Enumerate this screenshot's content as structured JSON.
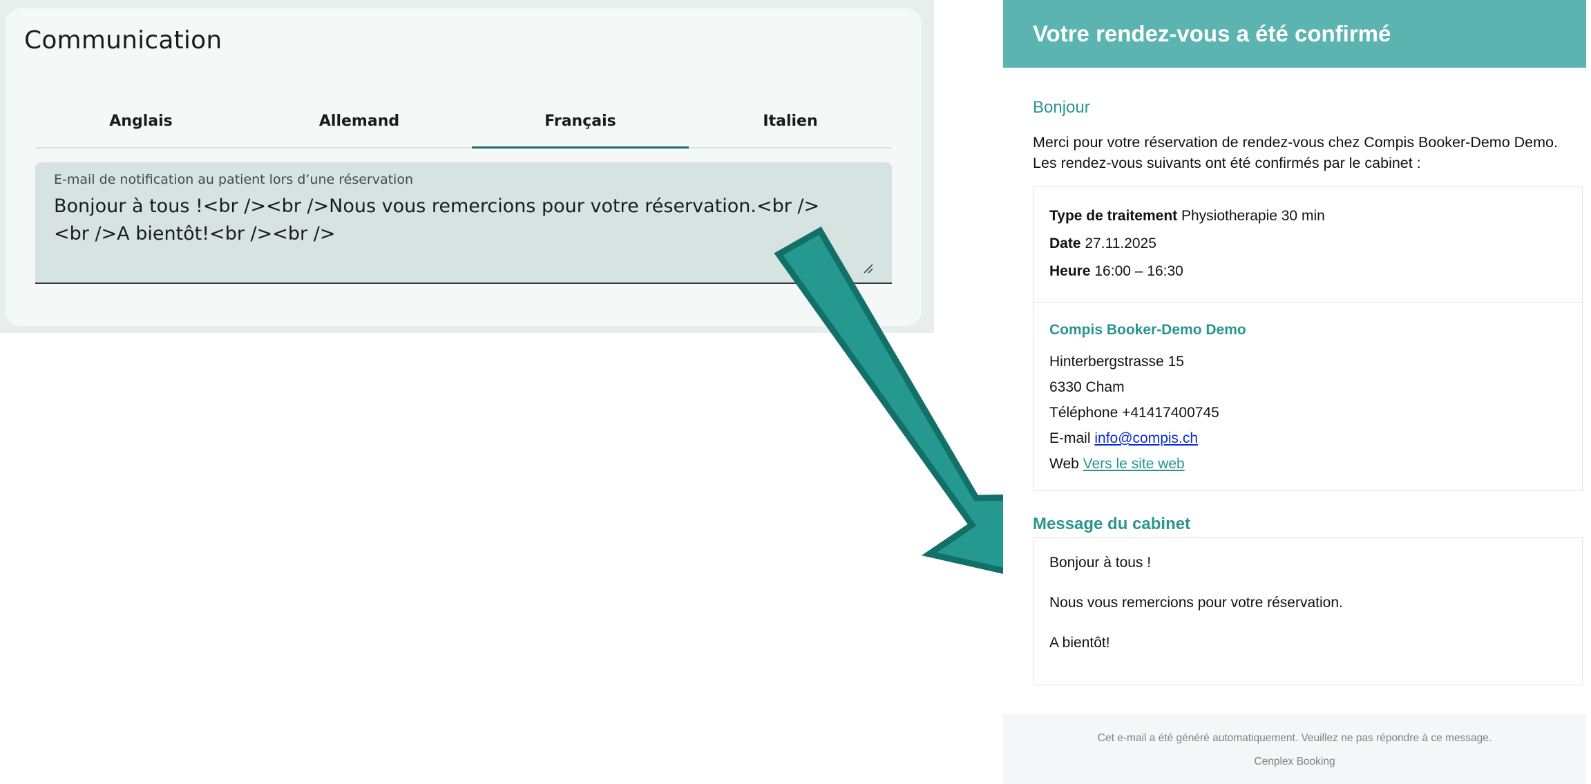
{
  "settings": {
    "section_title": "Communication",
    "tabs": [
      {
        "label": "Anglais",
        "active": false
      },
      {
        "label": "Allemand",
        "active": false
      },
      {
        "label": "Français",
        "active": true
      },
      {
        "label": "Italien",
        "active": false
      }
    ],
    "field": {
      "label": "E-mail de notification au patient lors d’une réservation",
      "value": "Bonjour à tous !<br /><br />Nous vous remercions pour votre réservation.<br /><br />A bientôt!<br /><br />"
    }
  },
  "email": {
    "header_title": "Votre rendez-vous a été confirmé",
    "greeting": "Bonjour",
    "intro_line1": "Merci pour votre réservation de rendez-vous chez Compis Booker-Demo Demo.",
    "intro_line2": "Les rendez-vous suivants ont été confirmés par le cabinet :",
    "appointment": {
      "type_label": "Type de traitement",
      "type_value": "Physiotherapie 30 min",
      "date_label": "Date",
      "date_value": "27.11.2025",
      "time_label": "Heure",
      "time_value": "16:00 – 16:30"
    },
    "clinic": {
      "name": "Compis Booker-Demo Demo",
      "street": "Hinterbergstrasse 15",
      "city": "6330 Cham",
      "phone_label": "Téléphone",
      "phone_value": "+41417400745",
      "email_label": "E-mail",
      "email_value": "info@compis.ch",
      "web_label": "Web",
      "web_link": "Vers le site web"
    },
    "message_title": "Message du cabinet",
    "message_lines": [
      "Bonjour à tous !",
      "Nous vous remercions pour votre réservation.",
      "A bientôt!"
    ],
    "footer_line1": "Cet e-mail a été généré automatiquement. Veuillez ne pas répondre à ce message.",
    "footer_line2": "Cenplex Booking"
  },
  "colors": {
    "accent_teal": "#5bb4b0",
    "text_teal": "#2a958d",
    "tab_indicator": "#1c6f6a",
    "arrow_fill": "#259990",
    "arrow_stroke": "#137068",
    "link_blue": "#0a2bd4"
  },
  "icons": {
    "resize_handle": "resize-handle-icon",
    "arrow": "arrow-down-right-icon"
  }
}
